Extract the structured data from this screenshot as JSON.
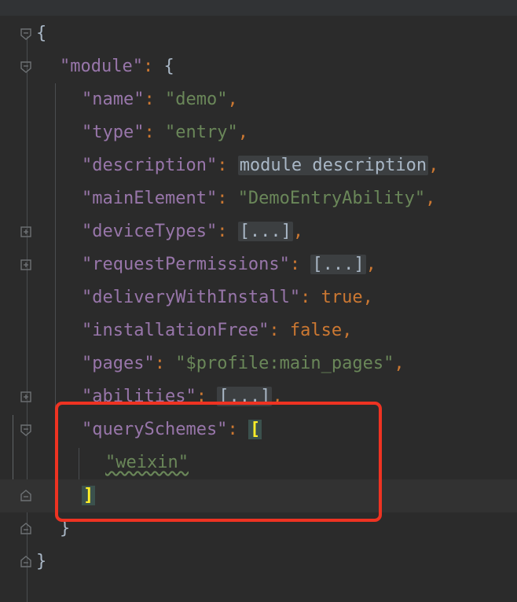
{
  "editor": {
    "lines": [
      {
        "open": "{"
      },
      {
        "key": "\"module\"",
        "colon": ":",
        "open": " {"
      },
      {
        "key": "\"name\"",
        "value": "\"demo\""
      },
      {
        "key": "\"type\"",
        "value": "\"entry\""
      },
      {
        "key": "\"description\"",
        "value": "module description"
      },
      {
        "key": "\"mainElement\"",
        "value": "\"DemoEntryAbility\""
      },
      {
        "key": "\"deviceTypes\"",
        "value": "[...]"
      },
      {
        "key": "\"requestPermissions\"",
        "value": "[...]"
      },
      {
        "key": "\"deliveryWithInstall\"",
        "value": "true"
      },
      {
        "key": "\"installationFree\"",
        "value": "false"
      },
      {
        "key": "\"pages\"",
        "value": "\"$profile:main_pages\""
      },
      {
        "key": "\"abilities\"",
        "value": "[...]"
      },
      {
        "key": "\"querySchemes\"",
        "value": "["
      },
      {
        "value": "\"weixin\""
      },
      {
        "value": "]"
      },
      {
        "value": "}"
      },
      {
        "value": "}"
      }
    ],
    "punct": {
      "colon": ":",
      "comma": ","
    }
  },
  "colors": {
    "background": "#2b2b2b",
    "key": "#9876aa",
    "string": "#6a8759",
    "keyword": "#cc7832",
    "highlight_box": "#ee3322"
  },
  "icons": {
    "fold_open": "fold-open-icon",
    "fold_collapsed": "fold-expand-icon",
    "fold_end": "fold-end-icon"
  }
}
